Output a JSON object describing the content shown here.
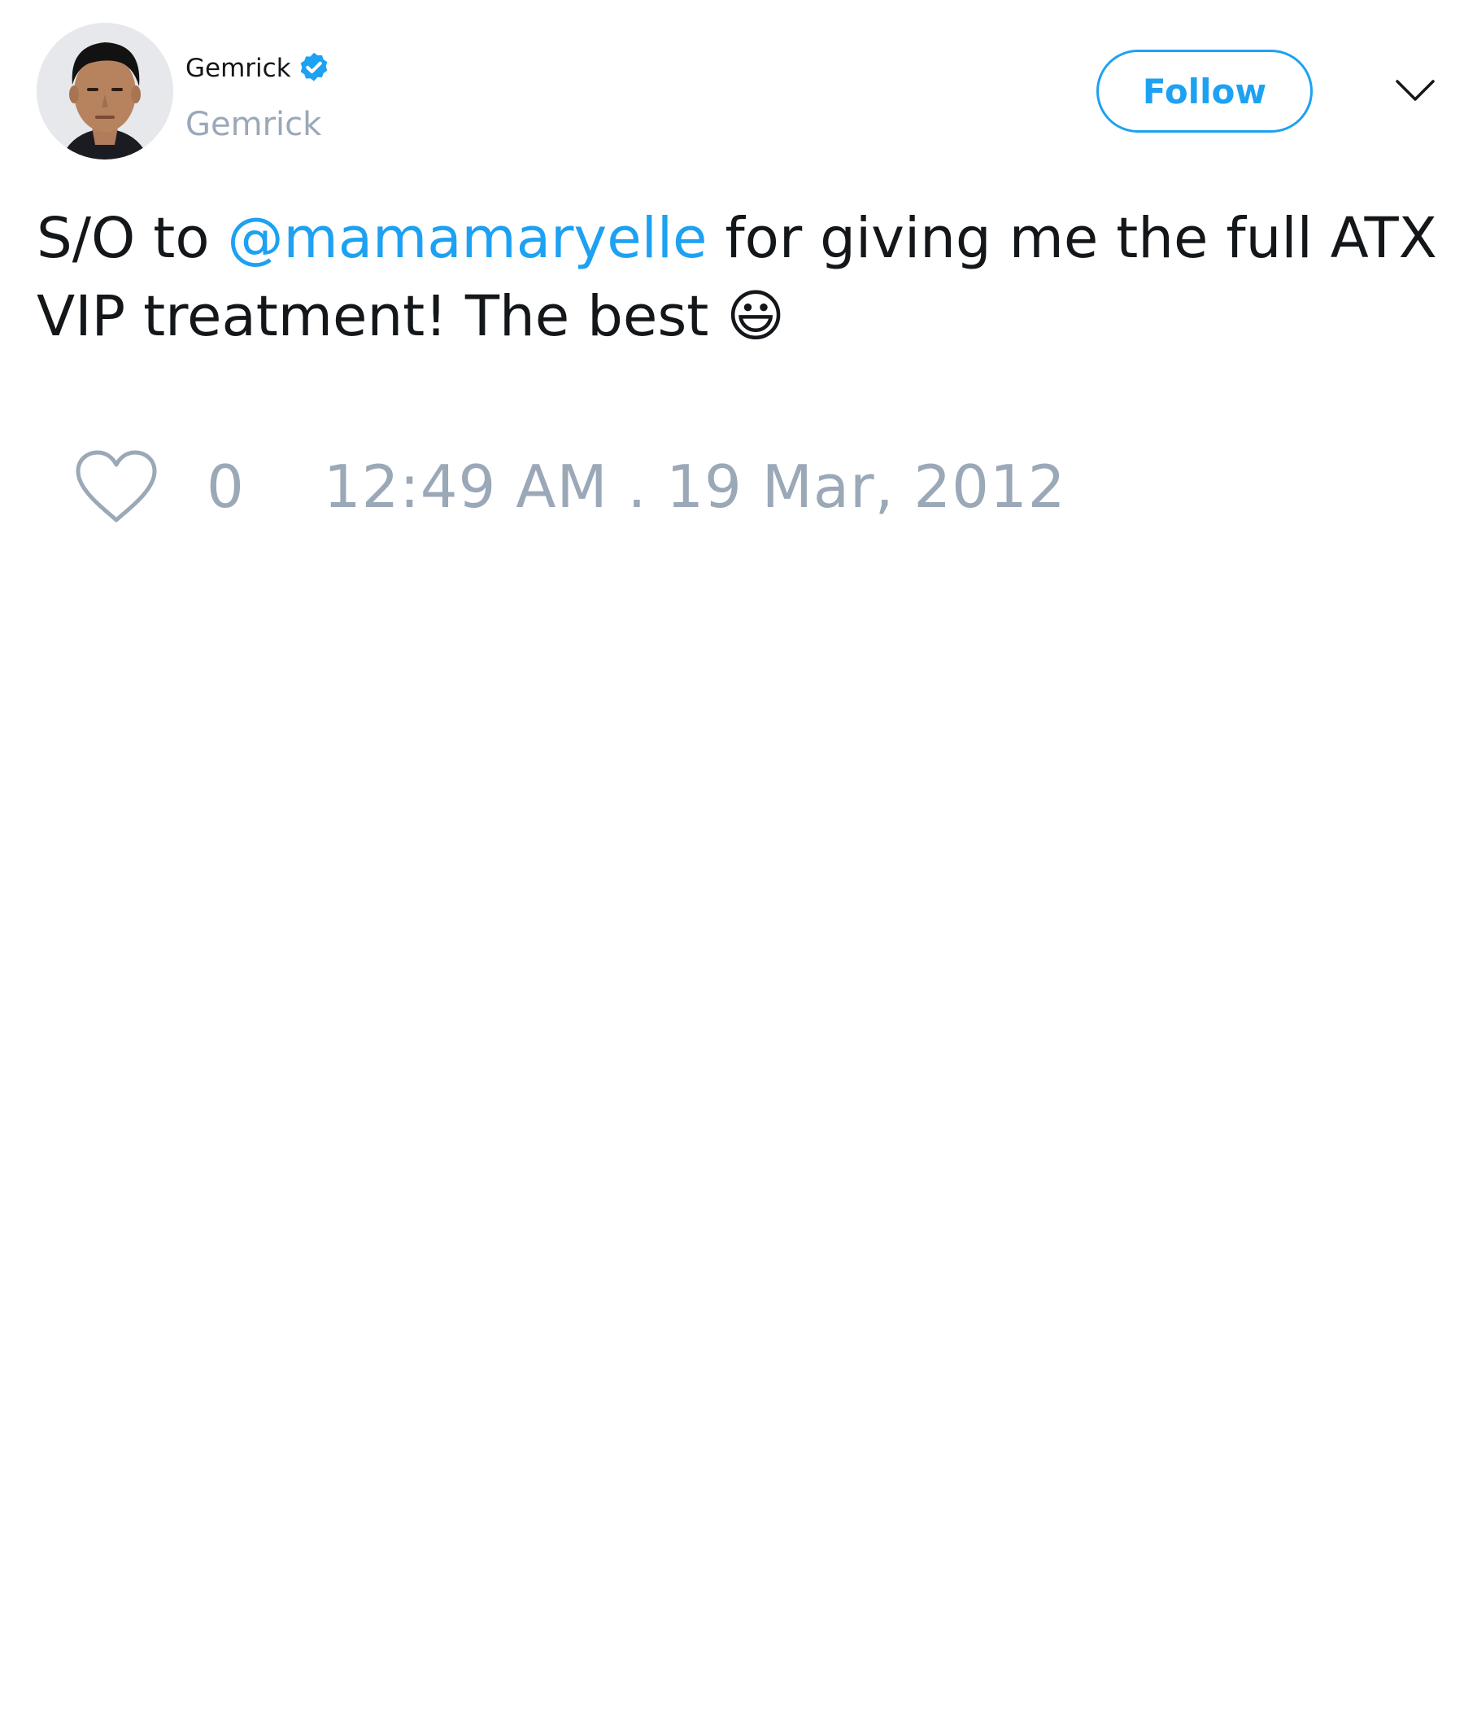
{
  "author": {
    "display_name": "Gemrick",
    "handle": "Gemrick",
    "verified": true,
    "avatar_icon": "avatar-photo"
  },
  "follow_button": {
    "label": "Follow"
  },
  "menu_icon": "chevron-down-icon",
  "tweet": {
    "text_before_mention": "S/O to ",
    "mention": "@mamamaryelle",
    "text_after_mention": " for giving me the full ATX VIP treatment! The best 😃"
  },
  "actions": {
    "like_icon": "heart-icon",
    "like_count": "0",
    "timestamp": "12:49 AM . 19 Mar, 2012"
  },
  "colors": {
    "accent": "#1da1f2",
    "muted": "#9aa8b8",
    "text": "#14171a"
  }
}
